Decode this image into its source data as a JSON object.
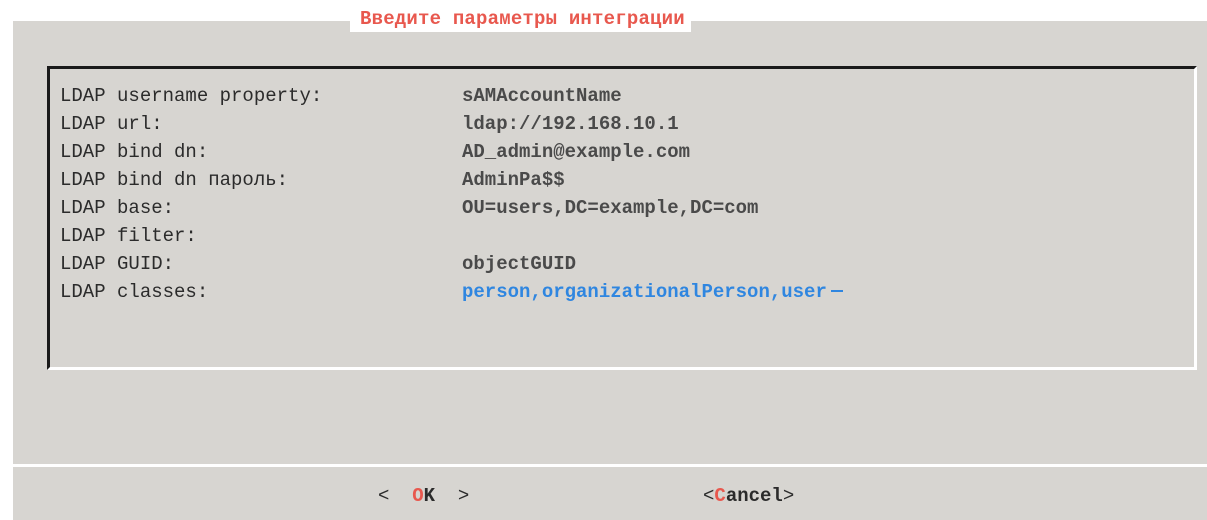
{
  "dialog": {
    "title": "Введите параметры интеграции"
  },
  "form": {
    "fields": [
      {
        "label": "LDAP username property:",
        "value": "sAMAccountName"
      },
      {
        "label": "LDAP url:",
        "value": "ldap://192.168.10.1"
      },
      {
        "label": "LDAP bind dn:",
        "value": "AD_admin@example.com"
      },
      {
        "label": "LDAP bind dn пароль:",
        "value": "AdminPa$$"
      },
      {
        "label": "LDAP base:",
        "value": "OU=users,DC=example,DC=com"
      },
      {
        "label": "LDAP filter:",
        "value": ""
      },
      {
        "label": "LDAP GUID:",
        "value": "objectGUID"
      },
      {
        "label": "LDAP classes:",
        "value": "person,organizationalPerson,user"
      }
    ]
  },
  "buttons": {
    "ok": {
      "open": "<  ",
      "hot": "O",
      "rest": "K",
      "close": "  >"
    },
    "cancel": {
      "open": "<",
      "hot": "C",
      "rest": "ancel",
      "close": ">"
    }
  },
  "colors": {
    "background": "#d7d5d1",
    "title": "#e8584e",
    "hotkey": "#e8584e",
    "active_field": "#2f86e0",
    "text": "#2b2b2b"
  }
}
